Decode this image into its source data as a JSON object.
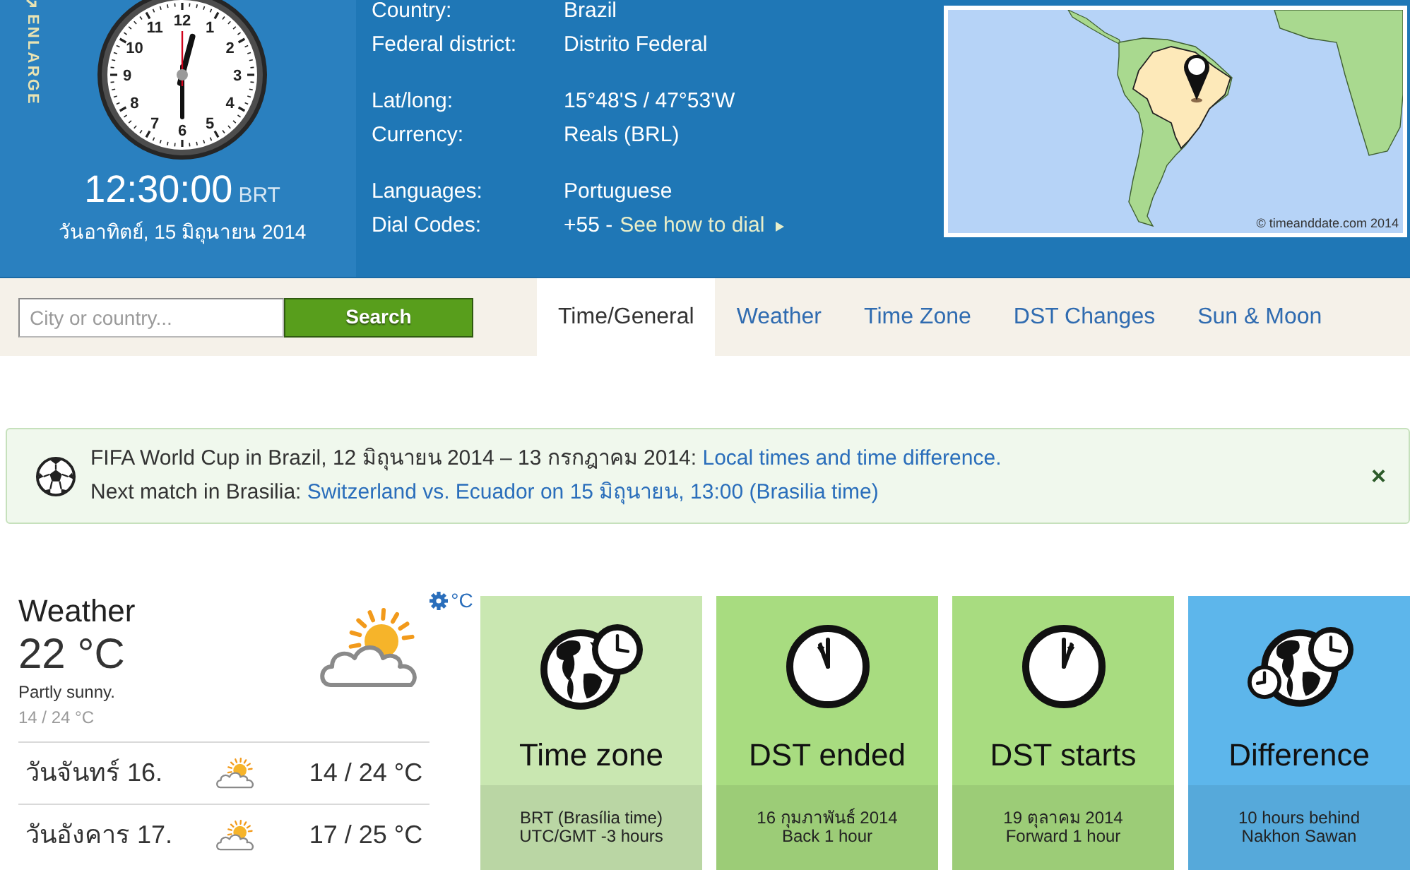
{
  "header": {
    "enlarge": "ENLARGE",
    "clock": {
      "numerals": [
        "12",
        "11",
        "1",
        "10",
        "2",
        "9",
        "3",
        "8",
        "4",
        "7",
        "5",
        "6"
      ],
      "time": "12:30:00",
      "zone": "BRT",
      "date": "วันอาทิตย์, 15 มิถุนายน 2014"
    },
    "info_groups": [
      [
        {
          "label": "Country:",
          "value": "Brazil"
        },
        {
          "label": "Federal district:",
          "value": "Distrito Federal"
        }
      ],
      [
        {
          "label": "Lat/long:",
          "value": "15°48'S / 47°53'W"
        },
        {
          "label": "Currency:",
          "value": "Reals (BRL)"
        }
      ],
      [
        {
          "label": "Languages:",
          "value": "Portuguese"
        },
        {
          "label": "Dial Codes:",
          "value": "+55 -",
          "link": "See how to dial"
        }
      ]
    ],
    "map": {
      "credit": "© timeanddate.com 2014"
    }
  },
  "search": {
    "placeholder": "City or country...",
    "button": "Search"
  },
  "tabs": [
    {
      "label": "Time/General",
      "selected": true
    },
    {
      "label": "Weather",
      "selected": false
    },
    {
      "label": "Time Zone",
      "selected": false
    },
    {
      "label": "DST Changes",
      "selected": false
    },
    {
      "label": "Sun & Moon",
      "selected": false
    }
  ],
  "banner": {
    "lines": [
      {
        "text": "FIFA World Cup in Brazil, 12 มิถุนายน 2014 – 13 กรกฎาคม 2014:",
        "link": "Local times and time difference."
      },
      {
        "text": "Next match in Brasilia:",
        "link": "Switzerland vs. Ecuador on 15 มิถุนายน, 13:00 (Brasilia time)"
      }
    ],
    "close": "×"
  },
  "weather": {
    "title": "Weather",
    "unit": "°C",
    "temperature": "22 °C",
    "condition": "Partly sunny.",
    "range": "14 / 24 °C",
    "forecast": [
      {
        "day": "วันจันทร์ 16.",
        "range": "14 / 24 °C"
      },
      {
        "day": "วันอังคาร 17.",
        "range": "17 / 25 °C"
      }
    ]
  },
  "cards": [
    {
      "kind": "timezone",
      "color": "#c9e7b1",
      "title": "Time zone",
      "lines": [
        "BRT (Brasília time)",
        "UTC/GMT -3 hours"
      ]
    },
    {
      "kind": "dstend",
      "color": "#a8dc80",
      "title": "DST ended",
      "lines": [
        "16 กุมภาพันธ์ 2014",
        "Back 1 hour"
      ]
    },
    {
      "kind": "dststart",
      "color": "#a8dc80",
      "title": "DST starts",
      "lines": [
        "19 ตุลาคม 2014",
        "Forward 1 hour"
      ]
    },
    {
      "kind": "difference",
      "color": "#5db6eb",
      "title": "Difference",
      "lines": [
        "10 hours behind",
        "Nakhon Sawan"
      ]
    }
  ]
}
